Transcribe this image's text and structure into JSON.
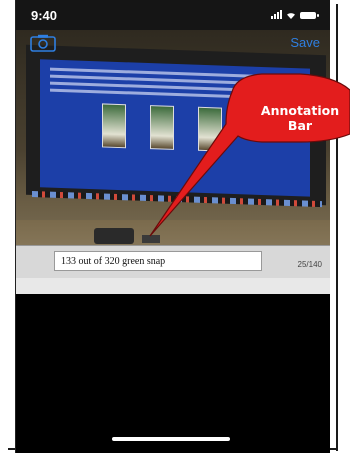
{
  "status_bar": {
    "time": "9:40"
  },
  "toolbar": {
    "camera_icon": "camera-icon",
    "save_label": "Save"
  },
  "annotation": {
    "value": "133 out of 320 green snap",
    "counter": "25/140"
  },
  "callout": {
    "line1": "Annotation",
    "line2": "Bar"
  },
  "colors": {
    "save_blue": "#2f7fe0",
    "callout_red": "#e31d1d"
  }
}
